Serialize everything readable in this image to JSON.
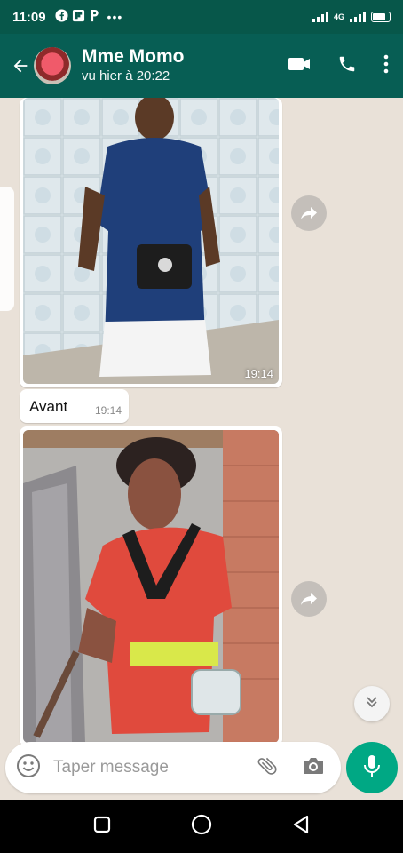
{
  "status_bar": {
    "time": "11:09",
    "network_label": "4G",
    "more": "•••"
  },
  "header": {
    "contact_name": "Mme Momo",
    "contact_status": "vu hier à 20:22"
  },
  "messages": [
    {
      "type": "image",
      "time": "19:14"
    },
    {
      "type": "text",
      "text": "Avant",
      "time": "19:14"
    },
    {
      "type": "image",
      "time": ""
    }
  ],
  "input": {
    "placeholder": "Taper message"
  },
  "colors": {
    "header": "#075e54",
    "status_bar": "#07574a",
    "chat_background": "#e9e1d8",
    "mic_button": "#00a884"
  },
  "icons": {
    "status": [
      "facebook-icon",
      "flipboard-icon",
      "p-app-icon",
      "signal-icon",
      "battery-icon"
    ],
    "header": [
      "back-arrow-icon",
      "video-call-icon",
      "phone-icon",
      "more-vert-icon"
    ],
    "chat": [
      "forward-icon",
      "chevron-double-down-icon"
    ],
    "input": [
      "emoji-icon",
      "attach-icon",
      "camera-icon",
      "mic-icon"
    ],
    "nav": [
      "recents-icon",
      "home-icon",
      "back-icon"
    ]
  }
}
